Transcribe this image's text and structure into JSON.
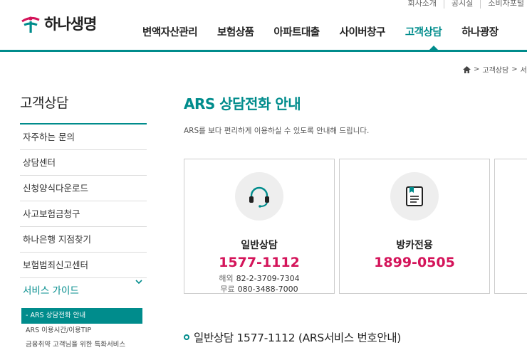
{
  "util": [
    "회사소개",
    "공시실",
    "소비자포털"
  ],
  "brand": {
    "name": "하나생명"
  },
  "gnb": [
    {
      "label": "변액자산관리",
      "x": 0
    },
    {
      "label": "보험상품"
    },
    {
      "label": "아파트대출"
    },
    {
      "label": "사이버창구"
    },
    {
      "label": "고객상담"
    },
    {
      "label": "하나광장"
    }
  ],
  "breadcrumb": [
    "고객상담",
    "서비스"
  ],
  "lnb": {
    "title": "고객상담",
    "items": [
      "자주하는 문의",
      "상담센터",
      "신청양식다운로드",
      "사고보험금청구",
      "하나은행 지점찾기",
      "보험범죄신고센터"
    ],
    "guide": "서비스 가이드",
    "sub": [
      "- ARS 상담전화 안내",
      "ARS 이용시간/이용TIP",
      "금융취약 고객님을 위한 특화서비스"
    ]
  },
  "page": {
    "title": "ARS 상담전화 안내",
    "desc": "ARS를 보다 편리하게 이용하실 수 있도록 안내해 드립니다."
  },
  "cards": [
    {
      "name": "일반상담",
      "number": "1577-1112",
      "overseas_label": "해외",
      "overseas": "82-2-3709-7304",
      "free_label": "무료",
      "free": "080-3488-7000",
      "icon": "headset-icon"
    },
    {
      "name": "방카전용",
      "number": "1899-0505",
      "icon": "document-icon"
    }
  ],
  "section": {
    "title": "일반상담 1577-1112 (ARS서비스 번호안내)"
  },
  "colors": {
    "accent": "#008c8c",
    "number": "#d4145a"
  }
}
